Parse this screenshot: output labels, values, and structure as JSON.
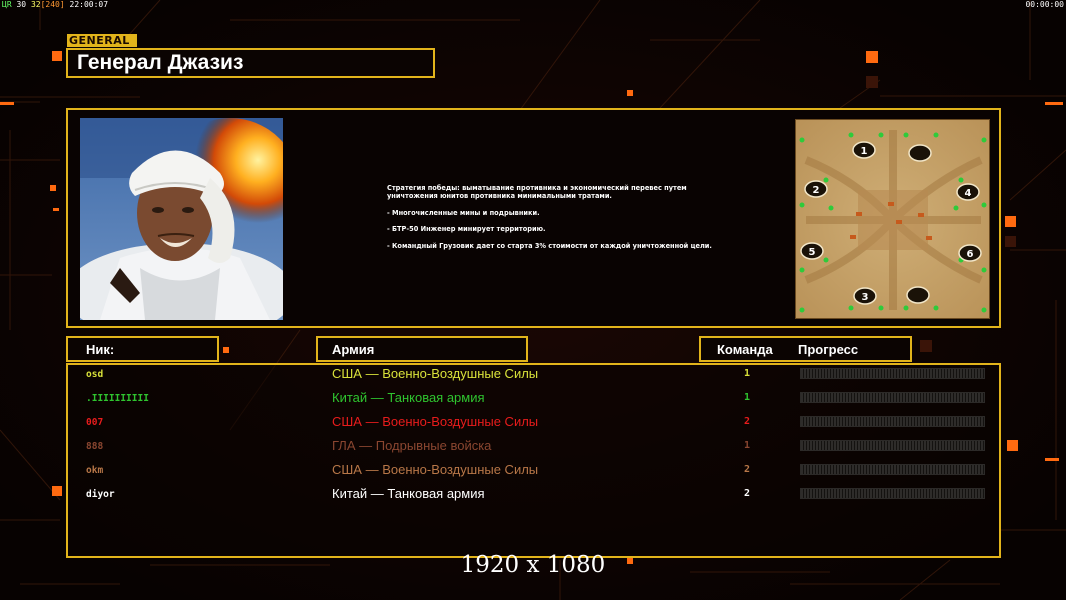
{
  "overlay": {
    "fps_label": "ЦR",
    "fps_value": "30",
    "fps_cap": "32",
    "fps_extra": "[240]",
    "game_time": "22:00:07",
    "timer": "00:00:00"
  },
  "general": {
    "tag": "GENERAL",
    "name": "Генерал Джазиз"
  },
  "description": [
    "Стратегия победы: выматывание противника и экономический перевес путем",
    " уничтожения юнитов противника минимальными тратами.",
    "",
    "- Многочисленные мины и подрывники.",
    "",
    "- БТР-50 Инженер минирует территорию.",
    "",
    "- Командный Грузовик дает со старта 3% стоимости от каждой уничтоженной цели."
  ],
  "minimap": {
    "start_positions": [
      "1",
      "2",
      "3",
      "4",
      "5",
      "6"
    ]
  },
  "columns": {
    "nick": "Ник:",
    "army": "Армия",
    "team": "Команда",
    "progress": "Прогресс"
  },
  "players": [
    {
      "nick": "osd",
      "army": "США — Военно-Воздушные Силы",
      "team": "1",
      "color": "#d9e23a",
      "progress": 0
    },
    {
      "nick": ".IIIIIIIIII",
      "army": "Китай — Танковая армия",
      "team": "1",
      "color": "#2fc42f",
      "progress": 0
    },
    {
      "nick": "007",
      "army": "США — Военно-Воздушные Силы",
      "team": "2",
      "color": "#e81c1c",
      "progress": 0
    },
    {
      "nick": "888",
      "army": "ГЛА — Подрывные войска",
      "team": "1",
      "color": "#8a4630",
      "progress": 0
    },
    {
      "nick": "okm",
      "army": "США — Военно-Воздушные Силы",
      "team": "2",
      "color": "#b87748",
      "progress": 0
    },
    {
      "nick": "diyor",
      "army": "Китай — Танковая армия",
      "team": "2",
      "color": "#ffffff",
      "progress": 0
    }
  ],
  "resolution": "1920 x 1080",
  "colors": {
    "accent": "#e2b41b",
    "background": "#0b0402",
    "grid_lines": "#3a1a0a",
    "highlight_squares": "#ff6a10"
  }
}
